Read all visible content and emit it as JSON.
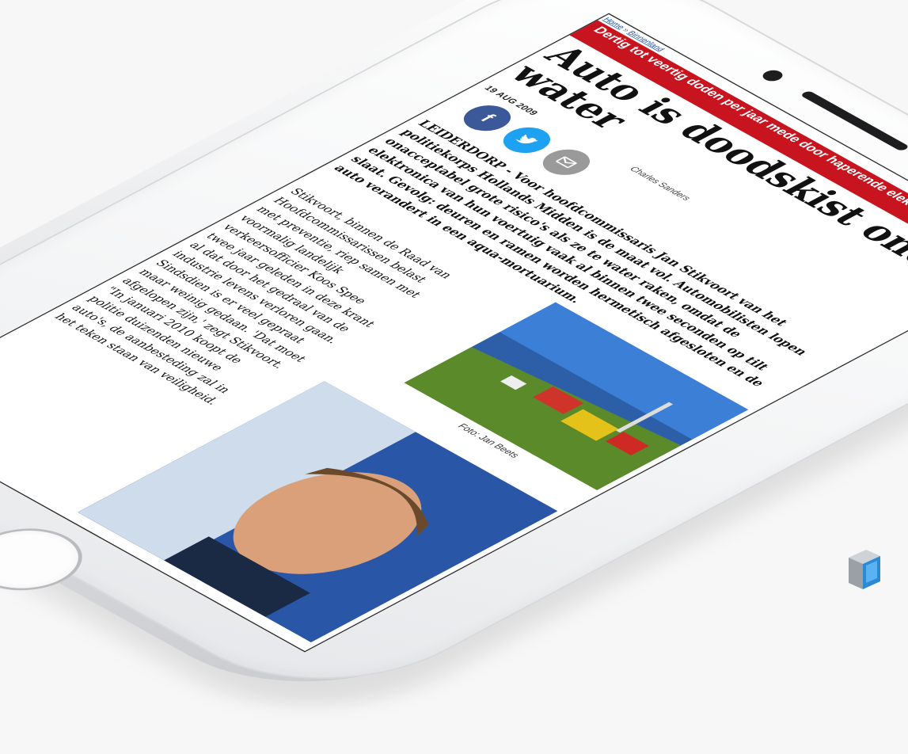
{
  "article": {
    "breadcrumb": [
      "Home",
      "Binnenland"
    ],
    "banner": "Dertig tot veertig doden per jaar mede door haperende elektronica",
    "headline": "Auto is doodskist onder water",
    "date": "19 AUG 2009",
    "author": "Charles Sanders",
    "lead_place": "Leiderdorp",
    "lead_text": " - Voor hoofdcommissaris Jan Stikvoort van het politiekorps Hollands Midden is de maat vol. Automobilisten lopen onacceptabel grote risico's als ze te water raken, omdat de elektronica van hun voertuig vaak al binnen twee seconden op tilt slaat. Gevolg: deuren en ramen worden hermetisch afgesloten en de auto verandert in een aqua-mortuarium.",
    "body_lines": [
      "Stikvoort, binnen de Raad van",
      "Hoofdcommissarissen belast",
      "met preventie, riep samen met",
      "voormalig landelijk",
      "verkeersofficier Koos Spee",
      "twee jaar geleden in deze krant",
      "al dat door het gedraal van de",
      "industrie levens verloren gaan.",
      "Sindsdien is er veel gepraat",
      "maar weinig gedaan. 'Dat moet",
      "afgelopen zijn,' zegt Stikvoort.",
      "\"In januari 2010 koopt de",
      "politie duizenden nieuwe",
      "auto's, de aanbesteding zal in",
      "het teken staan van veiligheid."
    ],
    "photo_caption": "Foto: Jan Beets"
  },
  "share": {
    "facebook_icon": "facebook-icon",
    "twitter_icon": "twitter-icon",
    "mail_icon": "mail-icon"
  },
  "colors": {
    "banner_red": "#c8141e",
    "facebook_blue": "#3b5998",
    "twitter_blue": "#1da1f2",
    "mail_grey": "#9a9a9a",
    "link_blue": "#1a4fb3"
  }
}
